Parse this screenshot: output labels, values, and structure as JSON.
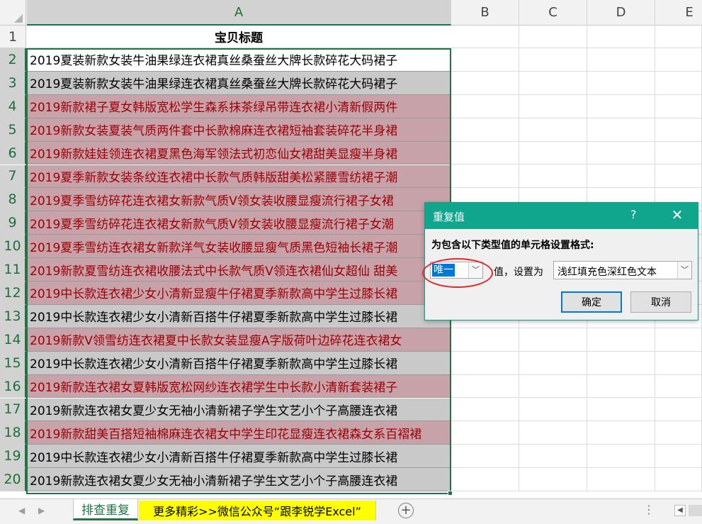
{
  "columns": [
    "A",
    "B",
    "C",
    "D",
    "E"
  ],
  "rows": [
    {
      "num": "1",
      "text": "宝贝标题",
      "style": "header"
    },
    {
      "num": "2",
      "text": "2019夏装新款女装牛油果绿连衣裙真丝桑蚕丝大牌长款碎花大码裙子",
      "style": "plain"
    },
    {
      "num": "3",
      "text": "2019夏装新款女装牛油果绿连衣裙真丝桑蚕丝大牌长款碎花大码裙子",
      "style": "gray"
    },
    {
      "num": "4",
      "text": "2019新款裙子夏女韩版宽松学生森系抹茶绿吊带连衣裙小清新假两件",
      "style": "dup"
    },
    {
      "num": "5",
      "text": "2019新款女装夏装气质两件套中长款棉麻连衣裙短袖套装碎花半身裙",
      "style": "dup"
    },
    {
      "num": "6",
      "text": "2019新款娃娃领连衣裙夏黑色海军领法式初恋仙女裙甜美显瘦半身裙",
      "style": "dup"
    },
    {
      "num": "7",
      "text": "2019夏季新款女装条纹连衣裙中长款气质韩版甜美松紧腰雪纺裙子潮",
      "style": "dup"
    },
    {
      "num": "8",
      "text": "2019夏季雪纺碎花连衣裙女新款气质V领女装收腰显瘦流行裙子女裙",
      "style": "dup"
    },
    {
      "num": "9",
      "text": "2019夏季雪纺碎花连衣裙女新款气质V领女装收腰显瘦流行裙子女潮",
      "style": "dup"
    },
    {
      "num": "10",
      "text": "2019夏季雪纺连衣裙女新款洋气女装收腰显瘦气质黑色短袖长裙子潮",
      "style": "dup"
    },
    {
      "num": "11",
      "text": "2019新款夏雪纺连衣裙收腰法式中长款气质V领连衣裙仙女超仙 甜美",
      "style": "dup"
    },
    {
      "num": "12",
      "text": "2019中长款连衣裙少女小清新显瘦牛仔裙夏季新款高中学生过膝长裙",
      "style": "dup"
    },
    {
      "num": "13",
      "text": "2019中长款连衣裙少女小清新百搭牛仔裙夏季新款高中学生过膝长裙",
      "style": "gray"
    },
    {
      "num": "14",
      "text": "2019新款V领雪纺连衣裙夏中长款女装显瘦A字版荷叶边碎花连衣裙女",
      "style": "dup"
    },
    {
      "num": "15",
      "text": "2019中长款连衣裙少女小清新百搭牛仔裙夏季新款高中学生过膝长裙",
      "style": "gray"
    },
    {
      "num": "16",
      "text": "2019新款连衣裙女夏韩版宽松网纱连衣裙学生中长款小清新套装裙子",
      "style": "dup"
    },
    {
      "num": "17",
      "text": "2019新款连衣裙女夏少女无袖小清新裙子学生文艺小个子高腰连衣裙",
      "style": "gray"
    },
    {
      "num": "18",
      "text": "2019新款甜美百搭短袖棉麻连衣裙女中学生印花显瘦连衣裙森女系百褶裙",
      "style": "dup"
    },
    {
      "num": "19",
      "text": "2019中长款连衣裙少女小清新百搭牛仔裙夏季新款高中学生过膝长裙",
      "style": "gray"
    },
    {
      "num": "20",
      "text": "2019新款连衣裙女夏少女无袖小清新裙子学生文艺小个子高腰连衣裙",
      "style": "gray"
    }
  ],
  "sheet_tabs": {
    "active": "排查重复",
    "promo": "更多精彩>>微信公众号“跟李锐学Excel”",
    "add_icon": "plus-circle-icon"
  },
  "dialog": {
    "title": "重复值",
    "help": "?",
    "close": "✕",
    "prompt": "为包含以下类型值的单元格设置格式:",
    "value_type": "唯一",
    "middle_text": "值，设置为",
    "format": "浅红填充色深红色文本",
    "ok": "确定",
    "cancel": "取消"
  },
  "colors": {
    "accent": "#217346",
    "dup_fill": "#c7a2a8",
    "dup_text": "#9c0006",
    "gray_fill": "#c9c9c9",
    "dialog_title": "#0fa68d",
    "annotation_circle": "#e02a2a",
    "promo_tab": "#ffff00"
  }
}
